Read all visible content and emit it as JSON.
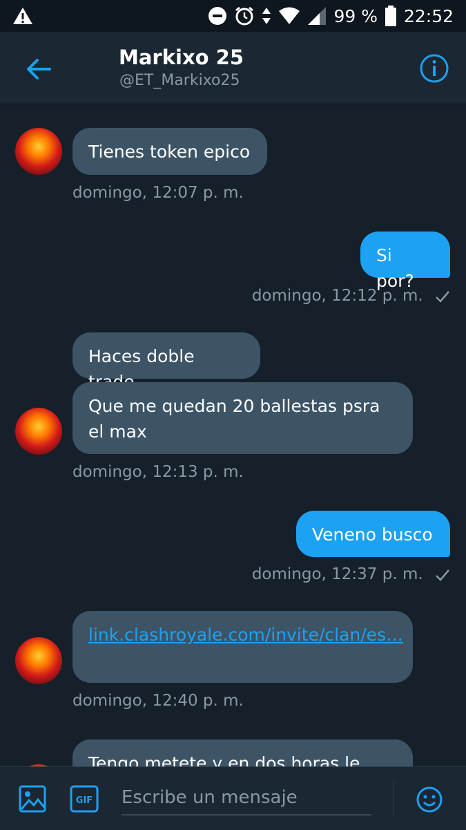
{
  "status_bar": {
    "battery_text": "99 %",
    "time": "22:52"
  },
  "header": {
    "name": "Markixo 25",
    "handle": "@ET_Markixo25"
  },
  "messages": [
    {
      "text": "Tienes token epico",
      "timestamp": "domingo, 12:07 p. m."
    },
    {
      "text": "Si por?",
      "timestamp": "domingo, 12:12 p. m."
    },
    {
      "text": "Haces doble trade"
    },
    {
      "text": "Que me quedan 20 ballestas psra el max",
      "timestamp": "domingo, 12:13 p. m."
    },
    {
      "text": "Veneno busco",
      "timestamp": "domingo, 12:37 p. m."
    },
    {
      "text": "link.clashroyale.com/invite/clan/es…",
      "timestamp": "domingo, 12:40 p. m."
    },
    {
      "text": "Tengo metete y en dos horas le"
    }
  ],
  "composer": {
    "placeholder": "Escribe un mensaje",
    "gif_label": "GIF"
  },
  "colors": {
    "background": "#15202b",
    "header": "#1b2733",
    "incoming_bubble": "#3d5466",
    "outgoing_bubble": "#1da1f2",
    "accent": "#1da1f2",
    "secondary_text": "#8899a6"
  },
  "icons": [
    "warning-icon",
    "do-not-disturb-icon",
    "alarm-icon",
    "data-arrows-icon",
    "wifi-icon",
    "signal-icon",
    "battery-icon",
    "back-arrow-icon",
    "info-icon",
    "avatar",
    "checkmark-icon",
    "image-icon",
    "gif-icon",
    "emoji-icon"
  ]
}
